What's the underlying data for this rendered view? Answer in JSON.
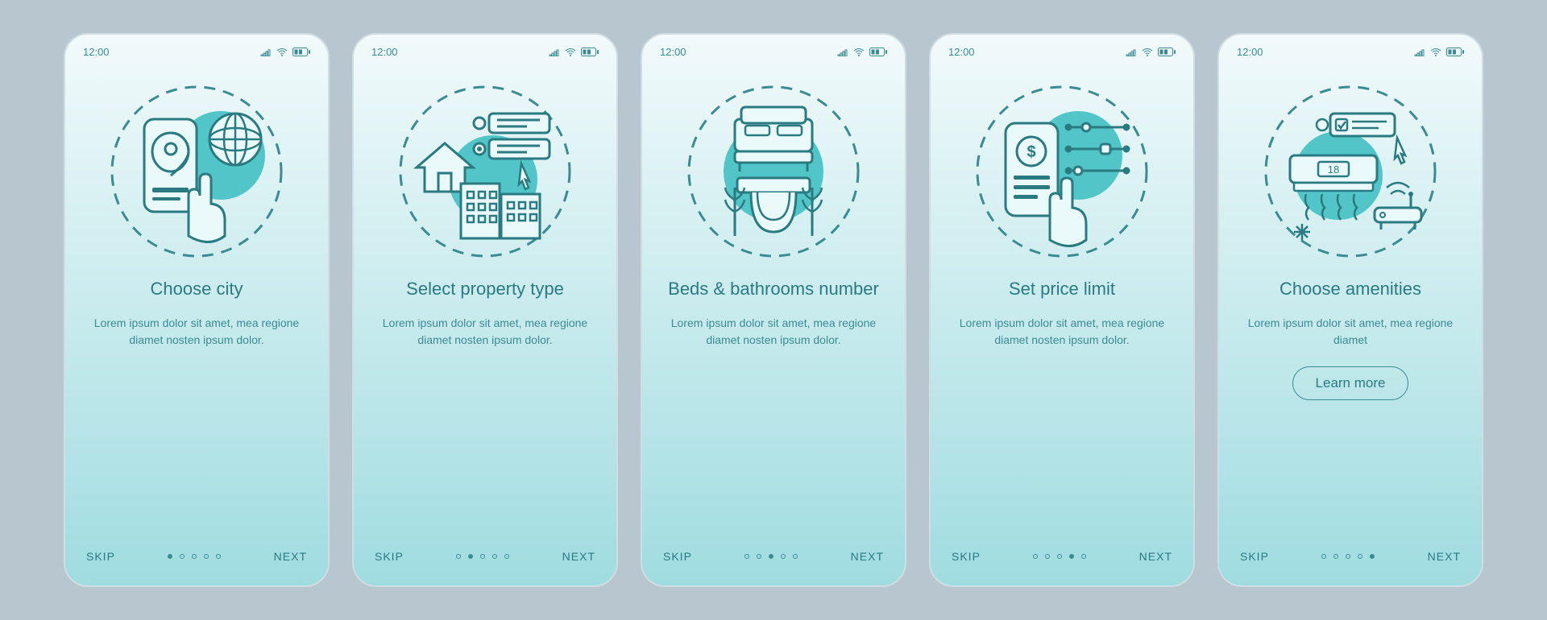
{
  "status": {
    "time": "12:00"
  },
  "nav": {
    "skip": "SKIP",
    "next": "NEXT",
    "dot_count": 5
  },
  "learn_more": "Learn more",
  "amenity_temp": "18",
  "screens": [
    {
      "title": "Choose city",
      "body": "Lorem ipsum dolor sit amet, mea regione diamet nosten ipsum dolor.",
      "learn_more": false,
      "active_dot": 0
    },
    {
      "title": "Select property type",
      "body": "Lorem ipsum dolor sit amet, mea regione diamet nosten ipsum dolor.",
      "learn_more": false,
      "active_dot": 1
    },
    {
      "title": "Beds & bathrooms number",
      "body": "Lorem ipsum dolor sit amet, mea regione diamet nosten ipsum dolor.",
      "learn_more": false,
      "active_dot": 2
    },
    {
      "title": "Set price limit",
      "body": "Lorem ipsum dolor sit amet, mea regione diamet nosten ipsum dolor.",
      "learn_more": false,
      "active_dot": 3
    },
    {
      "title": "Choose amenities",
      "body": "Lorem ipsum dolor sit amet, mea regione diamet",
      "learn_more": true,
      "active_dot": 4
    }
  ]
}
